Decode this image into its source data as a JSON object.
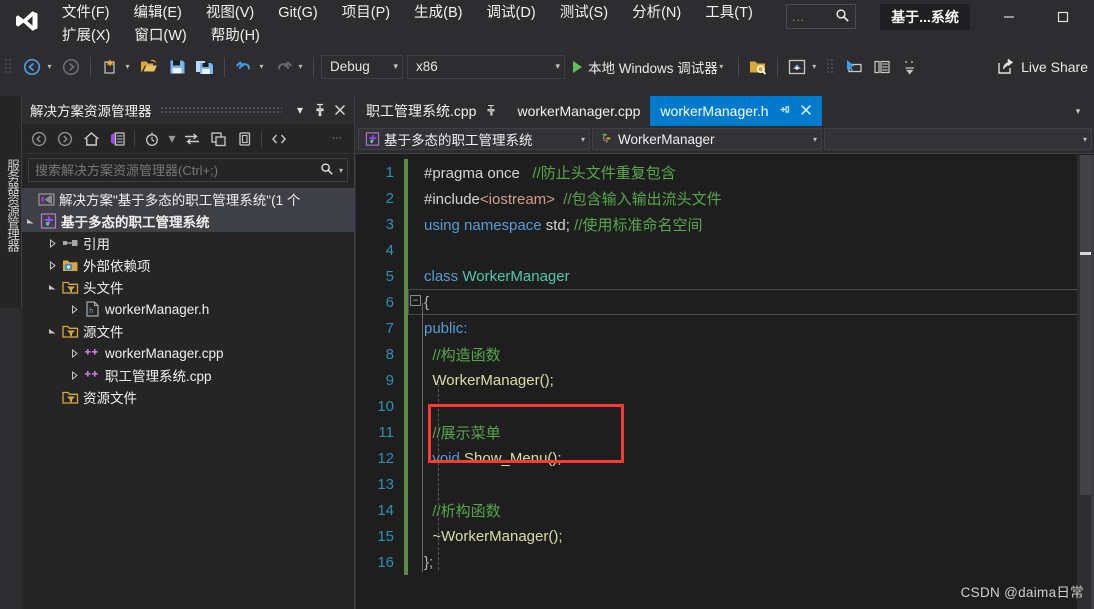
{
  "window": {
    "title": "基于...系统",
    "minimize_label": "—",
    "maximize_label": "▢",
    "search_placeholder": "...",
    "search_icon": "search-icon"
  },
  "menu": {
    "row1": [
      {
        "label": "文件(F)",
        "mnemonic": "F"
      },
      {
        "label": "编辑(E)",
        "mnemonic": "E"
      },
      {
        "label": "视图(V)",
        "mnemonic": "V"
      },
      {
        "label": "Git(G)",
        "mnemonic": "G"
      },
      {
        "label": "项目(P)",
        "mnemonic": "P"
      },
      {
        "label": "生成(B)",
        "mnemonic": "B"
      },
      {
        "label": "调试(D)",
        "mnemonic": "D"
      },
      {
        "label": "测试(S)",
        "mnemonic": "S"
      },
      {
        "label": "分析(N)",
        "mnemonic": "N"
      },
      {
        "label": "工具(T)",
        "mnemonic": "T"
      }
    ],
    "row2": [
      {
        "label": "扩展(X)",
        "mnemonic": "X"
      },
      {
        "label": "窗口(W)",
        "mnemonic": "W"
      },
      {
        "label": "帮助(H)",
        "mnemonic": "H"
      }
    ]
  },
  "toolbar": {
    "config": "Debug",
    "platform": "x86",
    "run_label": "本地 Windows 调试器",
    "live_share": "Live Share",
    "icons": [
      "navigate-back-icon",
      "navigate-forward-icon",
      "new-project-icon",
      "open-file-icon",
      "save-icon",
      "save-all-icon",
      "undo-icon",
      "redo-icon",
      "find-in-files-icon",
      "home-icon",
      "select-element-icon",
      "properties-window-icon",
      "sort-icon",
      "live-share-icon"
    ]
  },
  "server_explorer": {
    "vertical_tab_label": "服务器资源管理器"
  },
  "solution_explorer": {
    "title": "解决方案资源管理器",
    "header_icons": [
      "chevron-down-icon",
      "pin-icon",
      "close-icon"
    ],
    "toolbar_icons": [
      "back-icon",
      "forward-icon",
      "home-icon",
      "sync-with-active-doc-icon",
      "pending-changes-icon",
      "refresh-icon",
      "collapse-all-icon",
      "properties-icon",
      "show-all-files-icon",
      "overflow-icon"
    ],
    "search_placeholder": "搜索解决方案资源管理器(Ctrl+;)",
    "tree": [
      {
        "label": "解决方案\"基于多态的职工管理系统\"(1 个",
        "depth": 0,
        "twisty": "",
        "icon": "solution-icon",
        "selected": true,
        "bold": false
      },
      {
        "label": "基于多态的职工管理系统",
        "depth": 0,
        "twisty": "▲",
        "icon": "cpp-project-icon",
        "selected": true,
        "bold": true
      },
      {
        "label": "引用",
        "depth": 1,
        "twisty": "▷",
        "icon": "references-icon",
        "selected": false,
        "bold": false
      },
      {
        "label": "外部依赖项",
        "depth": 1,
        "twisty": "▷",
        "icon": "external-deps-icon",
        "selected": false,
        "bold": false
      },
      {
        "label": "头文件",
        "depth": 1,
        "twisty": "▲",
        "icon": "filter-folder-icon",
        "selected": false,
        "bold": false
      },
      {
        "label": "workerManager.h",
        "depth": 2,
        "twisty": "▷",
        "icon": "header-file-icon",
        "selected": false,
        "bold": false
      },
      {
        "label": "源文件",
        "depth": 1,
        "twisty": "▲",
        "icon": "filter-folder-icon",
        "selected": false,
        "bold": false
      },
      {
        "label": "workerManager.cpp",
        "depth": 2,
        "twisty": "▷",
        "icon": "cpp-file-icon",
        "selected": false,
        "bold": false
      },
      {
        "label": "职工管理系统.cpp",
        "depth": 2,
        "twisty": "▷",
        "icon": "cpp-file-icon",
        "selected": false,
        "bold": false
      },
      {
        "label": "资源文件",
        "depth": 1,
        "twisty": "",
        "icon": "filter-folder-icon",
        "selected": false,
        "bold": false
      }
    ]
  },
  "editor": {
    "tabs": [
      {
        "label": "职工管理系统.cpp",
        "active": false,
        "pinned": true,
        "closable": false
      },
      {
        "label": "workerManager.cpp",
        "active": false,
        "pinned": false,
        "closable": false
      },
      {
        "label": "workerManager.h",
        "active": true,
        "pinned": true,
        "closable": true
      }
    ],
    "tab_overflow_icon": "chevron-down-icon",
    "navbar": {
      "project": "基于多态的职工管理系统",
      "project_icon": "cpp-project-icon",
      "type": "WorkerManager",
      "type_icon": "class-icon",
      "member": ""
    },
    "active_color": "#007acc",
    "code_lines": [
      {
        "num": "1",
        "changed": true,
        "tokens": [
          {
            "t": "#pragma once",
            "c": "pre"
          },
          {
            "t": "   ",
            "c": "plain"
          },
          {
            "t": "//防止头文件重复包含",
            "c": "cmt"
          }
        ]
      },
      {
        "num": "2",
        "changed": true,
        "tokens": [
          {
            "t": "#include",
            "c": "pre"
          },
          {
            "t": "<iostream>",
            "c": "str"
          },
          {
            "t": "  ",
            "c": "plain"
          },
          {
            "t": "//包含输入输出流头文件",
            "c": "cmt"
          }
        ]
      },
      {
        "num": "3",
        "changed": true,
        "tokens": [
          {
            "t": "using namespace ",
            "c": "kw"
          },
          {
            "t": "std;",
            "c": "plain"
          },
          {
            "t": " ",
            "c": "plain"
          },
          {
            "t": "//使用标准命名空间",
            "c": "cmt"
          }
        ]
      },
      {
        "num": "4",
        "changed": true,
        "tokens": []
      },
      {
        "num": "5",
        "changed": true,
        "tokens": [
          {
            "t": "class ",
            "c": "kw"
          },
          {
            "t": "WorkerManager",
            "c": "cls-t"
          }
        ]
      },
      {
        "num": "6",
        "changed": true,
        "tokens": [
          {
            "t": "{",
            "c": "op"
          }
        ]
      },
      {
        "num": "7",
        "changed": true,
        "tokens": [
          {
            "t": "public:",
            "c": "kw"
          }
        ]
      },
      {
        "num": "8",
        "changed": true,
        "tokens": [
          {
            "t": "  //构造函数",
            "c": "cmt"
          }
        ]
      },
      {
        "num": "9",
        "changed": true,
        "tokens": [
          {
            "t": "  ",
            "c": "plain"
          },
          {
            "t": "WorkerManager();",
            "c": "fn"
          }
        ]
      },
      {
        "num": "10",
        "changed": true,
        "tokens": []
      },
      {
        "num": "11",
        "changed": true,
        "tokens": [
          {
            "t": "  //展示菜单",
            "c": "cmt"
          }
        ]
      },
      {
        "num": "12",
        "changed": true,
        "tokens": [
          {
            "t": "  void ",
            "c": "kw"
          },
          {
            "t": "Show_Menu();",
            "c": "fn"
          }
        ]
      },
      {
        "num": "13",
        "changed": true,
        "tokens": []
      },
      {
        "num": "14",
        "changed": true,
        "tokens": [
          {
            "t": "  //析构函数",
            "c": "cmt"
          }
        ]
      },
      {
        "num": "15",
        "changed": true,
        "tokens": [
          {
            "t": "  ",
            "c": "plain"
          },
          {
            "t": "~WorkerManager();",
            "c": "fn"
          }
        ]
      },
      {
        "num": "16",
        "changed": true,
        "tokens": [
          {
            "t": "};",
            "c": "op"
          }
        ]
      }
    ],
    "annotation": {
      "type": "red-rectangle",
      "color": "#ff3b30",
      "covers_lines": [
        "11",
        "12"
      ]
    }
  },
  "watermark": "CSDN @daima日常"
}
